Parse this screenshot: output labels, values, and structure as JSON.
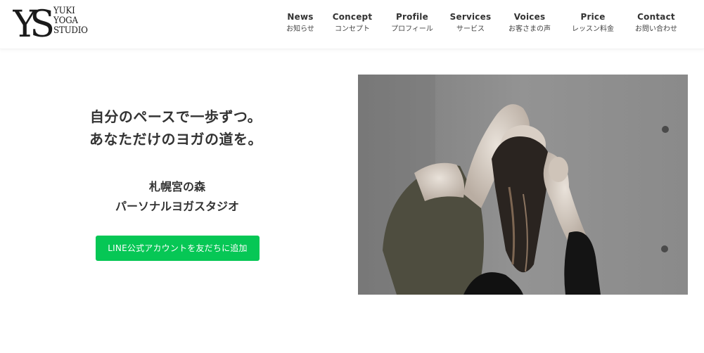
{
  "header": {
    "logo_lines": [
      "YUKI",
      "YOGA",
      "STUDIO"
    ],
    "logo_monogram": "YS",
    "nav": [
      {
        "en": "News",
        "ja": "お知らせ"
      },
      {
        "en": "Concept",
        "ja": "コンセプト"
      },
      {
        "en": "Profile",
        "ja": "プロフィール"
      },
      {
        "en": "Services",
        "ja": "サービス"
      },
      {
        "en": "Voices",
        "ja": "お客さまの声"
      },
      {
        "en": "Price",
        "ja": "レッスン料金"
      },
      {
        "en": "Contact",
        "ja": "お問い合わせ"
      }
    ]
  },
  "hero": {
    "catch_lines": [
      "自分のペースで一歩ずつ。",
      "あなただけのヨガの道を。"
    ],
    "studio_lines": [
      "札幌宮の森",
      "パーソナルヨガスタジオ"
    ],
    "line_button_label": "LINE公式アカウントを友だちに追加",
    "photo_alt": "ヨガのポーズをとる女性"
  },
  "colors": {
    "line_green": "#06c755",
    "text": "#333333",
    "header_bg": "#ffffff"
  }
}
